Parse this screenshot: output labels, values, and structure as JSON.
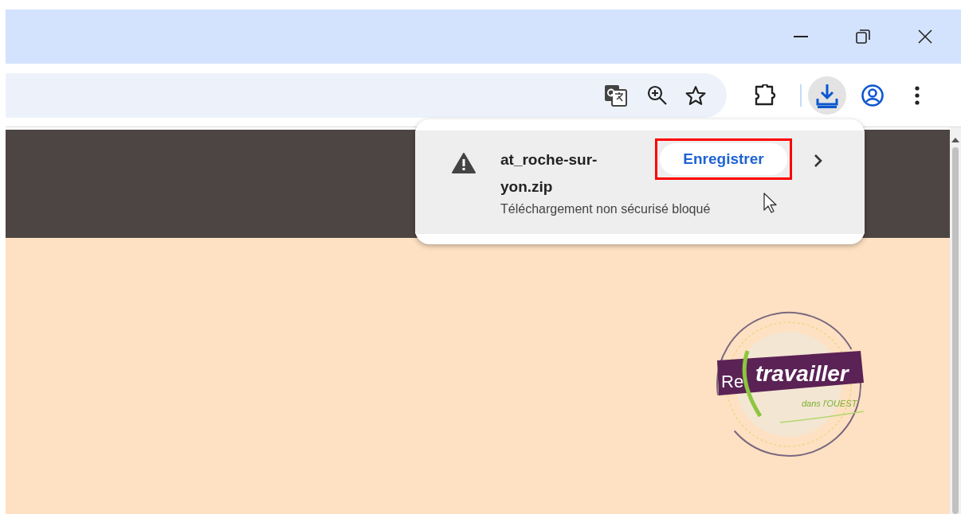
{
  "download_bubble": {
    "file_name": "at_roche-sur-yon.zip",
    "status": "Téléchargement non sécurisé bloqué",
    "save_button": {
      "label": "Enregistrer",
      "highlighted": true
    }
  },
  "logo": {
    "prefix": "Re",
    "word": "travailler",
    "tagline": "dans l'OUEST"
  }
}
